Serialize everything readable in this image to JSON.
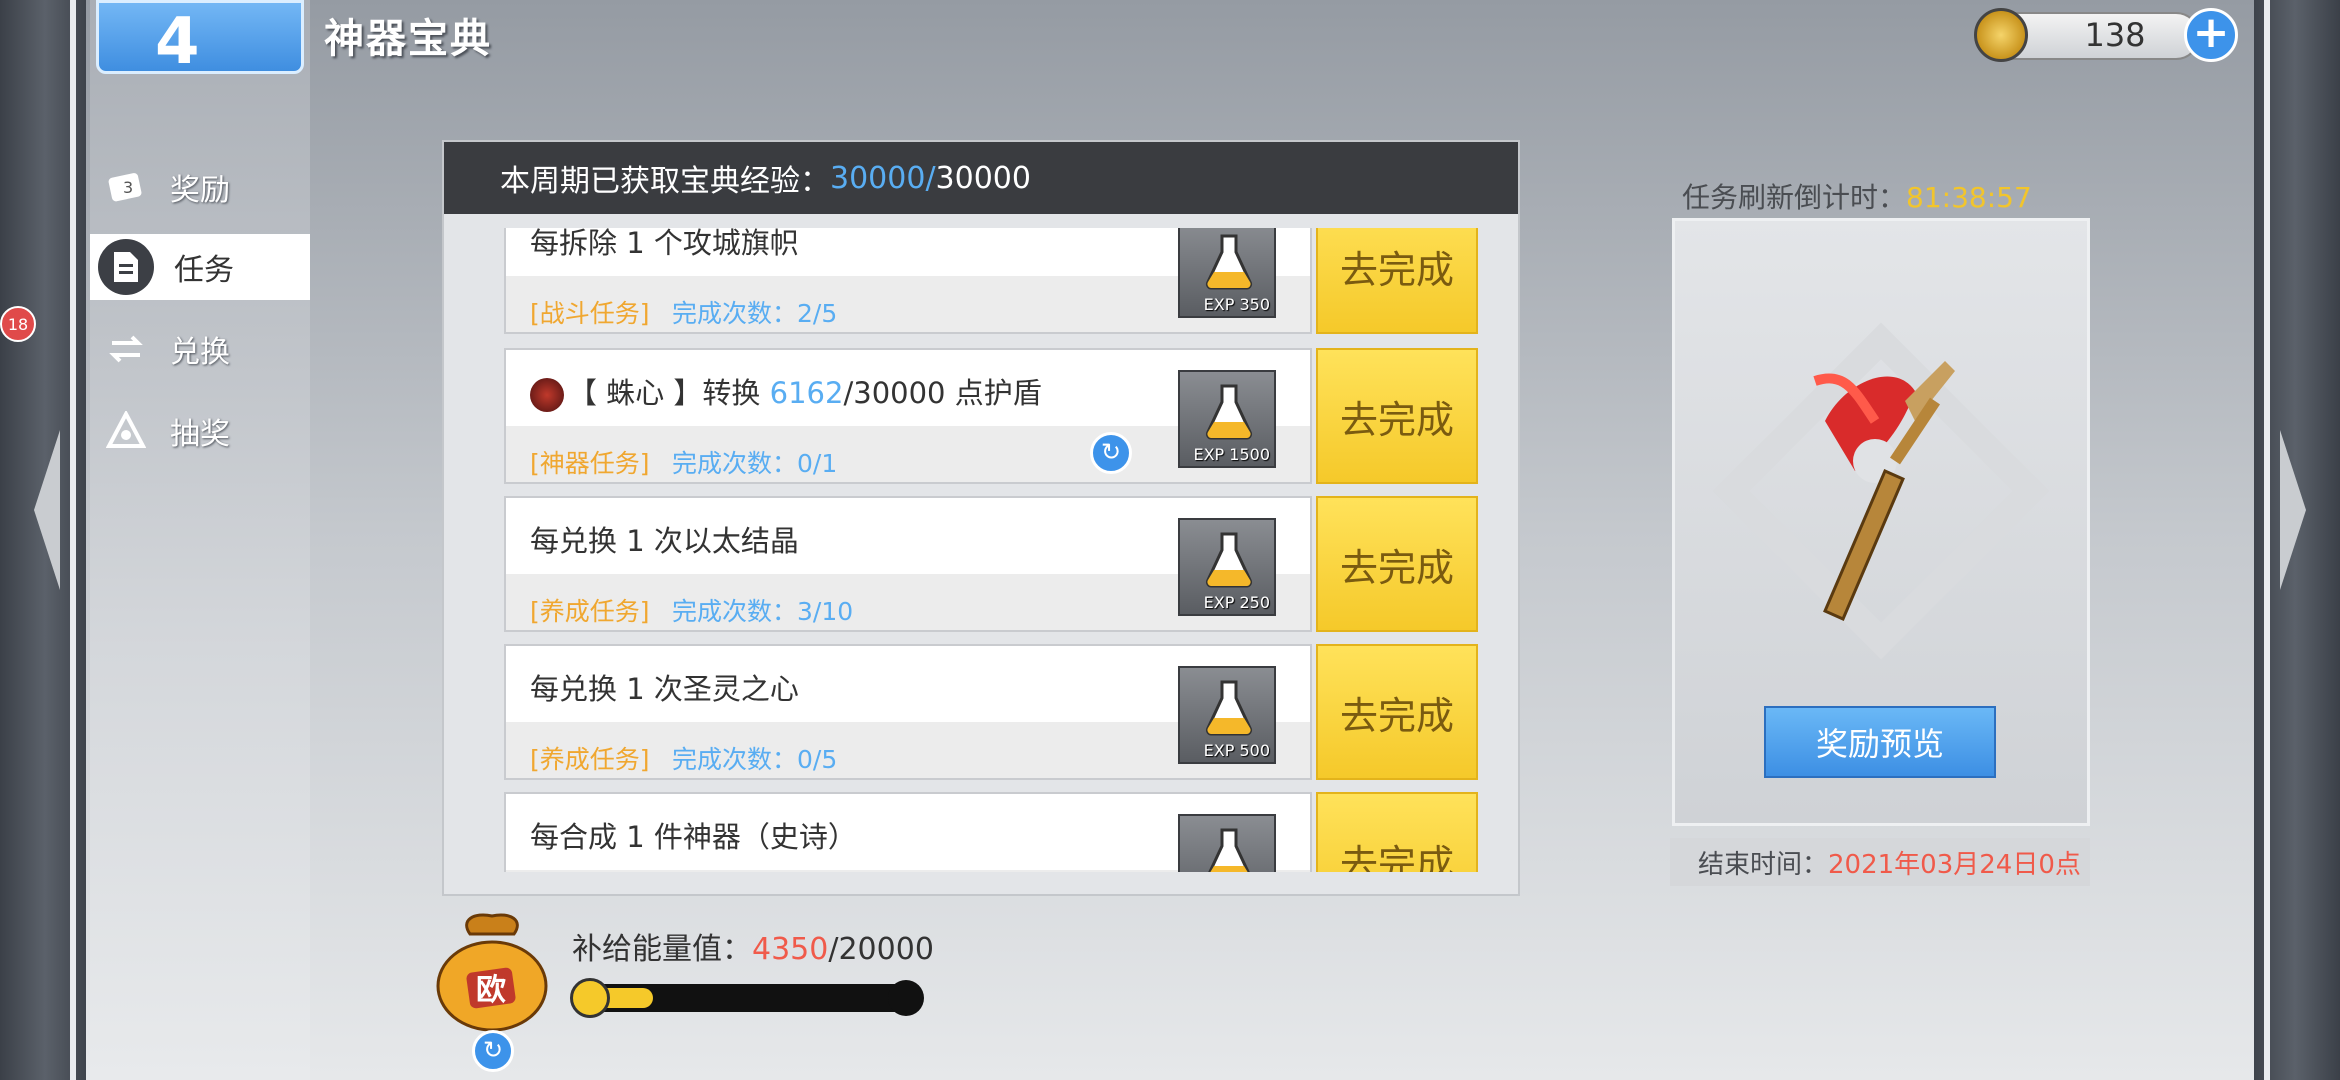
{
  "header": {
    "logo_glyph": "4",
    "title": "神器宝典"
  },
  "currency": {
    "amount": "138",
    "plus": "+"
  },
  "side_badge": "18",
  "sidebar": {
    "items": [
      {
        "label": "奖励",
        "icon": "book-icon"
      },
      {
        "label": "任务",
        "icon": "document-icon",
        "active": true
      },
      {
        "label": "兑换",
        "icon": "exchange-icon"
      },
      {
        "label": "抽奖",
        "icon": "lottery-icon"
      }
    ]
  },
  "weekly": {
    "label": "本周期已获取宝典经验：",
    "current": "30000",
    "separator": "/",
    "max": "30000"
  },
  "tasks": [
    {
      "name": "每拆除 1 个攻城旗帜",
      "category": "[战斗任务]",
      "count": "完成次数：2/5",
      "exp": "EXP 350",
      "action": "去完成"
    },
    {
      "name_prefix": "【 蛛心 】转换 ",
      "name_highlight": "6162",
      "name_suffix": "/30000 点护盾",
      "category": "[神器任务]",
      "count": "完成次数：0/1",
      "exp": "EXP 1500",
      "action": "去完成",
      "has_refresh": true
    },
    {
      "name": "每兑换 1 次以太结晶",
      "category": "[养成任务]",
      "count": "完成次数：3/10",
      "exp": "EXP 250",
      "action": "去完成"
    },
    {
      "name": "每兑换 1 次圣灵之心",
      "category": "[养成任务]",
      "count": "完成次数：0/5",
      "exp": "EXP 500",
      "action": "去完成"
    },
    {
      "name": "每合成 1 件神器（史诗）",
      "category": "",
      "count": "",
      "exp": "",
      "action": "去完成"
    }
  ],
  "energy": {
    "label": "补给能量值：",
    "current": "4350",
    "separator": "/",
    "max": "20000",
    "fraction": 0.2175
  },
  "refresh": {
    "label": "任务刷新倒计时：",
    "time": "81:38:57"
  },
  "preview": {
    "button": "奖励预览",
    "end_label": "结束时间：",
    "end_value": "2021年03月24日0点"
  }
}
